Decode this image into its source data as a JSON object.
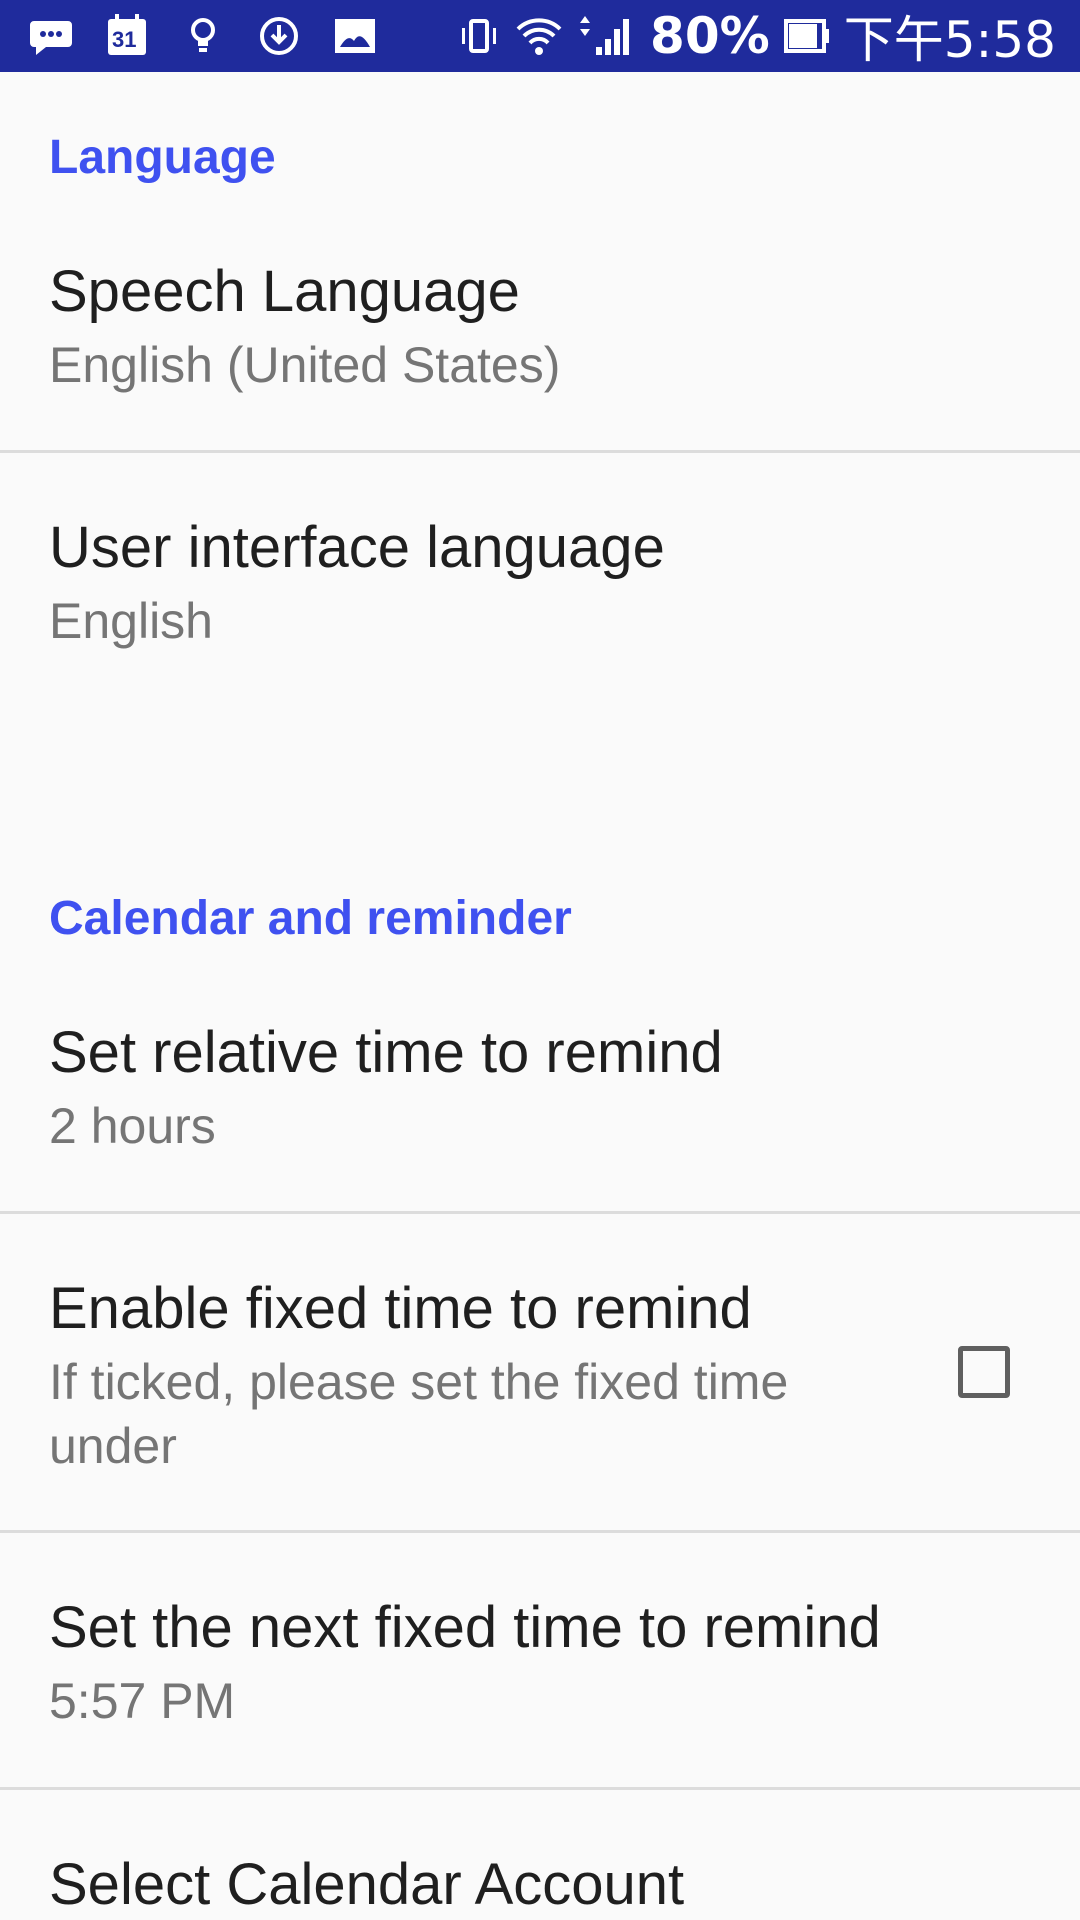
{
  "status_bar": {
    "calendar_date": "31",
    "battery_percent": "80%",
    "clock": "下午5:58",
    "icons": [
      "message-icon",
      "calendar-icon",
      "bulb-icon",
      "download-icon",
      "photo-icon",
      "vibrate-icon",
      "wifi-icon",
      "signal-icon",
      "battery-icon"
    ]
  },
  "sections": [
    {
      "header": "Language",
      "items": [
        {
          "title": "Speech Language",
          "summary": "English (United States)"
        },
        {
          "title": "User interface language",
          "summary": "English"
        }
      ]
    },
    {
      "header": "Calendar and reminder",
      "items": [
        {
          "title": "Set relative time to remind",
          "summary": "2 hours"
        },
        {
          "title": "Enable fixed time to remind",
          "summary": "If ticked, please set the fixed time under",
          "checkbox": false
        },
        {
          "title": "Set the next fixed time to remind",
          "summary": "5:57 PM"
        },
        {
          "title": "Select Calendar Account",
          "summary": ""
        }
      ]
    }
  ],
  "colors": {
    "status_bar": "#1f2b9c",
    "accent": "#3f51f0",
    "background": "#fafafa",
    "title_text": "#1f1f1f",
    "summary_text": "#757575",
    "divider": "#dcdcdc"
  }
}
